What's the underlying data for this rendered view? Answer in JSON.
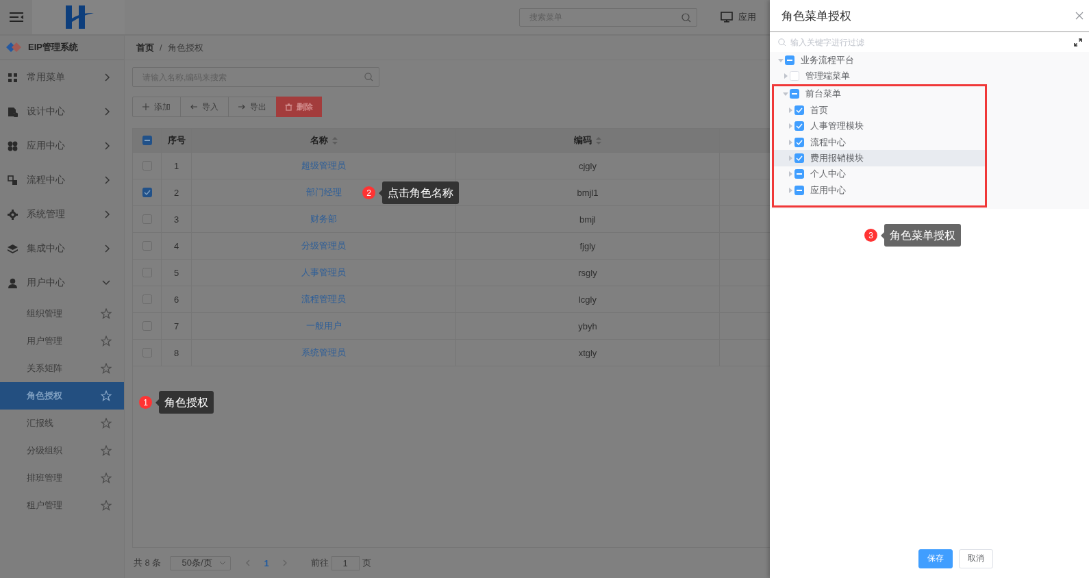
{
  "header": {
    "search": {
      "placeholder": "搜索菜单"
    },
    "app_link": "应用"
  },
  "sidebar": {
    "title": "EIP管理系统",
    "items": [
      {
        "label": "常用菜单",
        "expanded": false
      },
      {
        "label": "设计中心",
        "expanded": false
      },
      {
        "label": "应用中心",
        "expanded": false
      },
      {
        "label": "流程中心",
        "expanded": false
      },
      {
        "label": "系统管理",
        "expanded": false
      },
      {
        "label": "集成中心",
        "expanded": false
      },
      {
        "label": "用户中心",
        "expanded": true,
        "children": [
          {
            "label": "组织管理",
            "selected": false
          },
          {
            "label": "用户管理",
            "selected": false
          },
          {
            "label": "关系矩阵",
            "selected": false
          },
          {
            "label": "角色授权",
            "selected": true
          },
          {
            "label": "汇报线",
            "selected": false
          },
          {
            "label": "分级组织",
            "selected": false
          },
          {
            "label": "排班管理",
            "selected": false
          },
          {
            "label": "租户管理",
            "selected": false
          }
        ]
      }
    ]
  },
  "breadcrumb": {
    "items": [
      "首页",
      "角色授权"
    ],
    "separator": "/"
  },
  "search": {
    "placeholder": "请输入名称,编码来搜索"
  },
  "toolbar": [
    {
      "label": "添加",
      "kind": "add"
    },
    {
      "label": "导入",
      "kind": "import"
    },
    {
      "label": "导出",
      "kind": "export"
    },
    {
      "label": "删除",
      "kind": "delete"
    }
  ],
  "table": {
    "header_checked": false,
    "header_indeterminate": true,
    "columns": [
      {
        "label": "序号",
        "sortable": false
      },
      {
        "label": "名称",
        "sortable": true
      },
      {
        "label": "编码",
        "sortable": true
      }
    ],
    "rows": [
      {
        "index": "1",
        "name": "超级管理员",
        "code": "cjgly",
        "checked": false
      },
      {
        "index": "2",
        "name": "部门经理",
        "code": "bmjl1",
        "checked": true
      },
      {
        "index": "3",
        "name": "财务部",
        "code": "bmjl",
        "checked": false
      },
      {
        "index": "4",
        "name": "分级管理员",
        "code": "fjgly",
        "checked": false
      },
      {
        "index": "5",
        "name": "人事管理员",
        "code": "rsgly",
        "checked": false
      },
      {
        "index": "6",
        "name": "流程管理员",
        "code": "lcgly",
        "checked": false
      },
      {
        "index": "7",
        "name": "一般用户",
        "code": "ybyh",
        "checked": false
      },
      {
        "index": "8",
        "name": "系统管理员",
        "code": "xtgly",
        "checked": false
      }
    ]
  },
  "pagination": {
    "total": "共 8 条",
    "page_size": "50条/页",
    "pages": [
      {
        "label": "1",
        "selected": true
      }
    ],
    "goto_label": "前往",
    "goto_value": "1",
    "goto_suffix": "页"
  },
  "drawer": {
    "title": "角色菜单授权",
    "filter": {
      "placeholder": "输入关键字进行过滤"
    },
    "tree": [
      {
        "label": "业务流程平台",
        "checked": false,
        "indeterminate": true,
        "expanded": true,
        "highlighted": false,
        "framed": false,
        "children": [
          {
            "label": "管理端菜单",
            "checked": false,
            "indeterminate": false,
            "expanded": false,
            "highlighted": false,
            "framed": false
          },
          {
            "label": "前台菜单",
            "checked": false,
            "indeterminate": true,
            "expanded": true,
            "highlighted": false,
            "framed": true,
            "children": [
              {
                "label": "首页",
                "checked": true,
                "expanded": false,
                "highlighted": false,
                "framed": false
              },
              {
                "label": "人事管理模块",
                "checked": true,
                "expanded": false,
                "highlighted": false,
                "framed": false
              },
              {
                "label": "流程中心",
                "checked": true,
                "expanded": false,
                "highlighted": false,
                "framed": false
              },
              {
                "label": "费用报销模块",
                "checked": true,
                "expanded": false,
                "highlighted": true,
                "framed": false
              },
              {
                "label": "个人中心",
                "checked": false,
                "indeterminate": true,
                "expanded": false,
                "highlighted": false,
                "framed": false
              },
              {
                "label": "应用中心",
                "checked": false,
                "indeterminate": true,
                "expanded": false,
                "highlighted": false,
                "framed": false
              }
            ]
          }
        ]
      }
    ],
    "buttons": [
      {
        "label": "保存",
        "kind": "primary"
      },
      {
        "label": "取消",
        "kind": "default"
      }
    ]
  },
  "tips": [
    {
      "number": "1",
      "text": "角色授权"
    },
    {
      "number": "2",
      "text": "点击角色名称"
    },
    {
      "number": "3",
      "text": "角色菜单授权"
    }
  ]
}
